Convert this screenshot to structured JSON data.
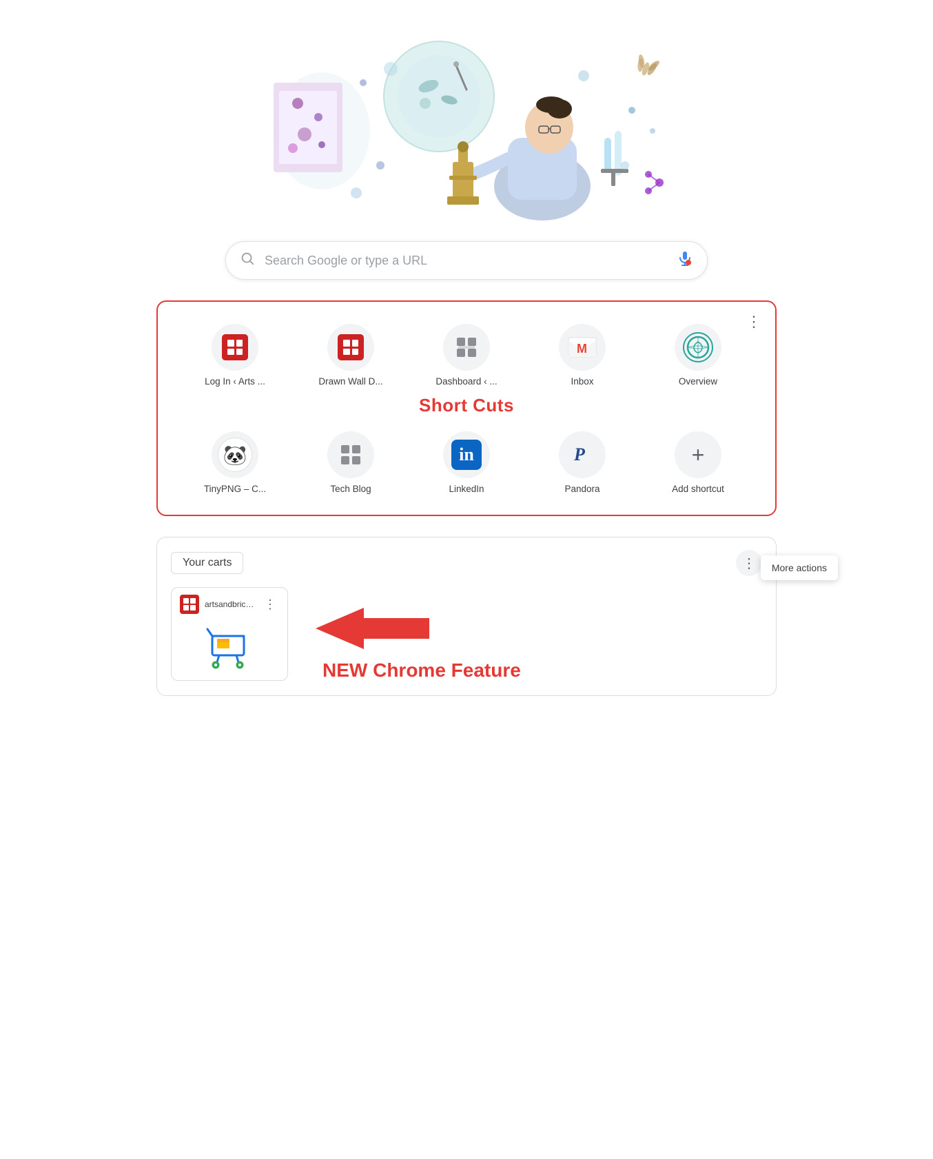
{
  "search": {
    "placeholder": "Search Google or type a URL"
  },
  "shortcuts": {
    "section_label": "Short Cuts",
    "more_button_label": "⋮",
    "items_row1": [
      {
        "id": "log-in-arts",
        "label": "Log In ‹ Arts ...",
        "icon": "artsbricks"
      },
      {
        "id": "drawn-wall",
        "label": "Drawn Wall D...",
        "icon": "artsbricks2"
      },
      {
        "id": "dashboard",
        "label": "Dashboard ‹ ...",
        "icon": "dashboard"
      },
      {
        "id": "inbox",
        "label": "Inbox",
        "icon": "gmail"
      },
      {
        "id": "overview",
        "label": "Overview",
        "icon": "overview"
      }
    ],
    "items_row2": [
      {
        "id": "tinypng",
        "label": "TinyPNG – C...",
        "icon": "tinypng"
      },
      {
        "id": "tech-blog",
        "label": "Tech Blog",
        "icon": "techblog"
      },
      {
        "id": "linkedin",
        "label": "LinkedIn",
        "icon": "linkedin"
      },
      {
        "id": "pandora",
        "label": "Pandora",
        "icon": "pandora"
      },
      {
        "id": "add-shortcut",
        "label": "Add shortcut",
        "icon": "add"
      }
    ]
  },
  "carts": {
    "title": "Your carts",
    "more_button_label": "⋮",
    "more_actions_tooltip": "More actions",
    "annotation_text": "NEW Chrome Feature",
    "site": {
      "name": "artsandbricks.c...",
      "dots": "⋮"
    }
  }
}
